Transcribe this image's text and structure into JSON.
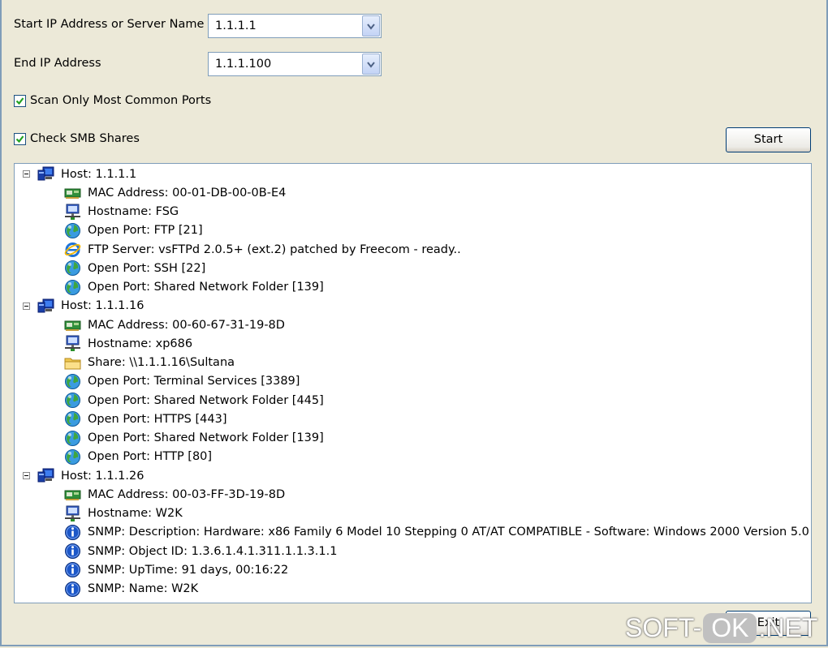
{
  "form": {
    "start_label": "Start IP Address or Server Name",
    "start_value": "1.1.1.1",
    "end_label": "End IP Address",
    "end_value": "1.1.1.100",
    "scan_common_label": "Scan Only Most Common Ports",
    "scan_common_checked": true,
    "check_smb_label": "Check SMB Shares",
    "check_smb_checked": true,
    "start_button": "Start",
    "exit_button": "Exit"
  },
  "tree": {
    "hosts": [
      {
        "label": "Host: 1.1.1.1",
        "items": [
          {
            "icon": "network-card-icon",
            "text": "MAC Address: 00-01-DB-00-0B-E4"
          },
          {
            "icon": "computer-network-icon",
            "text": "Hostname: FSG"
          },
          {
            "icon": "globe-port-icon",
            "text": "Open Port: FTP [21]"
          },
          {
            "icon": "internet-explorer-icon",
            "text": "FTP Server: vsFTPd 2.0.5+ (ext.2) patched by Freecom - ready.."
          },
          {
            "icon": "globe-port-icon",
            "text": "Open Port: SSH [22]"
          },
          {
            "icon": "globe-port-icon",
            "text": "Open Port: Shared Network Folder [139]"
          }
        ]
      },
      {
        "label": "Host: 1.1.1.16",
        "items": [
          {
            "icon": "network-card-icon",
            "text": "MAC Address: 00-60-67-31-19-8D"
          },
          {
            "icon": "computer-network-icon",
            "text": "Hostname: xp686"
          },
          {
            "icon": "folder-icon",
            "text": "Share: \\\\1.1.1.16\\Sultana"
          },
          {
            "icon": "globe-port-icon",
            "text": "Open Port: Terminal Services [3389]"
          },
          {
            "icon": "globe-port-icon",
            "text": "Open Port: Shared Network Folder [445]"
          },
          {
            "icon": "globe-port-icon",
            "text": "Open Port: HTTPS [443]"
          },
          {
            "icon": "globe-port-icon",
            "text": "Open Port: Shared Network Folder [139]"
          },
          {
            "icon": "globe-port-icon",
            "text": "Open Port: HTTP [80]"
          }
        ]
      },
      {
        "label": "Host: 1.1.1.26",
        "items": [
          {
            "icon": "network-card-icon",
            "text": "MAC Address: 00-03-FF-3D-19-8D"
          },
          {
            "icon": "computer-network-icon",
            "text": "Hostname: W2K"
          },
          {
            "icon": "info-icon",
            "text": "SNMP: Description: Hardware: x86 Family 6 Model 10 Stepping 0 AT/AT COMPATIBLE - Software: Windows 2000 Version 5.0"
          },
          {
            "icon": "info-icon",
            "text": "SNMP: Object ID: 1.3.6.1.4.1.311.1.1.3.1.1"
          },
          {
            "icon": "info-icon",
            "text": "SNMP: UpTime: 91 days, 00:16:22"
          },
          {
            "icon": "info-icon",
            "text": "SNMP: Name: W2K"
          }
        ]
      }
    ]
  },
  "watermark": {
    "left": "SOFT-",
    "middle": "OK",
    "right": ".NET"
  }
}
